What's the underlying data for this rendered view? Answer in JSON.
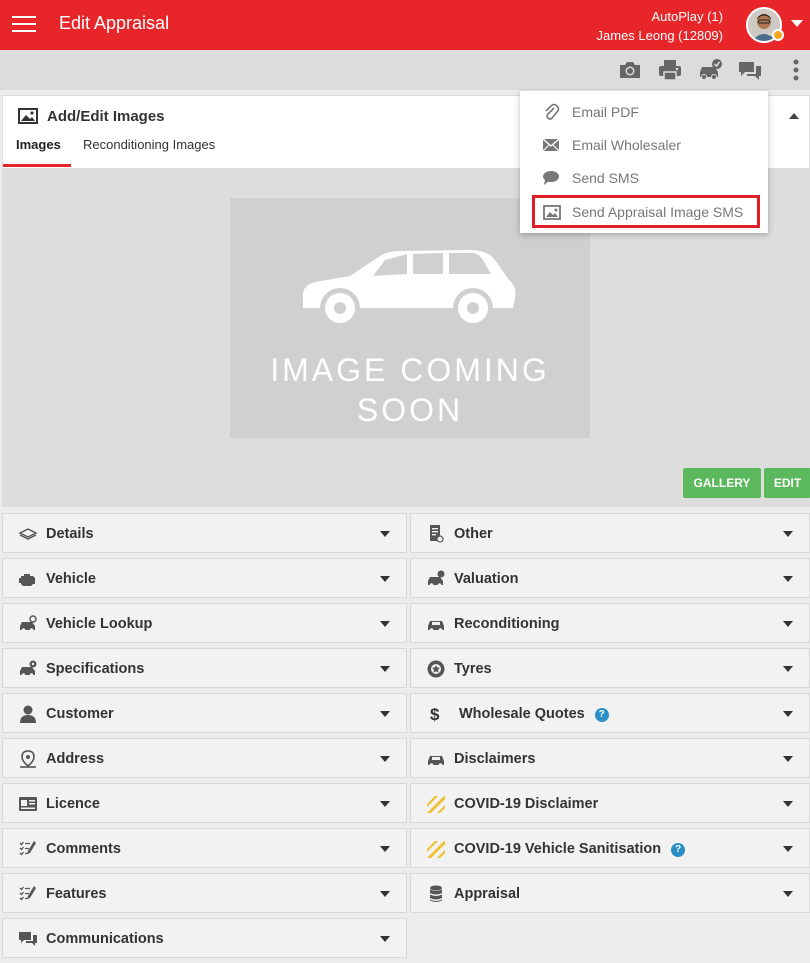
{
  "header": {
    "title": "Edit Appraisal",
    "dealer": "AutoPlay (1)",
    "user": "James Leong (12809)"
  },
  "toolbar": {
    "icons": [
      "camera-icon",
      "printer-icon",
      "car-check-icon",
      "chat-icon",
      "more-vertical-icon"
    ]
  },
  "images_panel": {
    "title": "Add/Edit Images",
    "tabs": [
      "Images",
      "Reconditioning Images"
    ],
    "placeholder_line1": "IMAGE COMING",
    "placeholder_line2": "SOON",
    "gallery_button": "GALLERY",
    "edit_button": "EDIT"
  },
  "dropdown": {
    "items": [
      {
        "label": "Email PDF",
        "icon": "paperclip-icon"
      },
      {
        "label": "Email Wholesaler",
        "icon": "envelope-icon"
      },
      {
        "label": "Send SMS",
        "icon": "chat-bubble-icon"
      },
      {
        "label": "Send Appraisal Image SMS",
        "icon": "image-icon"
      }
    ]
  },
  "sections_left": [
    {
      "label": "Details",
      "icon": "layers-icon"
    },
    {
      "label": "Vehicle",
      "icon": "engine-icon"
    },
    {
      "label": "Vehicle Lookup",
      "icon": "car-search-icon"
    },
    {
      "label": "Specifications",
      "icon": "car-gear-icon"
    },
    {
      "label": "Customer",
      "icon": "person-icon"
    },
    {
      "label": "Address",
      "icon": "map-pin-icon"
    },
    {
      "label": "Licence",
      "icon": "id-card-icon"
    },
    {
      "label": "Comments",
      "icon": "checklist-pen-icon"
    },
    {
      "label": "Features",
      "icon": "checklist-pen-icon"
    },
    {
      "label": "Communications",
      "icon": "chat-icon"
    }
  ],
  "sections_right": [
    {
      "label": "Other",
      "icon": "document-icon"
    },
    {
      "label": "Valuation",
      "icon": "car-dollar-icon"
    },
    {
      "label": "Reconditioning",
      "icon": "car-icon"
    },
    {
      "label": "Tyres",
      "icon": "tyre-icon"
    },
    {
      "label": "Wholesale Quotes",
      "icon": "dollar-icon",
      "help": "?"
    },
    {
      "label": "Disclaimers",
      "icon": "car-icon"
    },
    {
      "label": "COVID-19 Disclaimer",
      "icon": "hazard-stripes-icon"
    },
    {
      "label": "COVID-19 Vehicle Sanitisation",
      "icon": "hazard-stripes-icon",
      "help": "?"
    },
    {
      "label": "Appraisal",
      "icon": "database-icon"
    }
  ],
  "colors": {
    "brand": "#e8262a",
    "green": "#5cb85c",
    "help": "#2a8fc6",
    "hazard": "#f0c030"
  }
}
